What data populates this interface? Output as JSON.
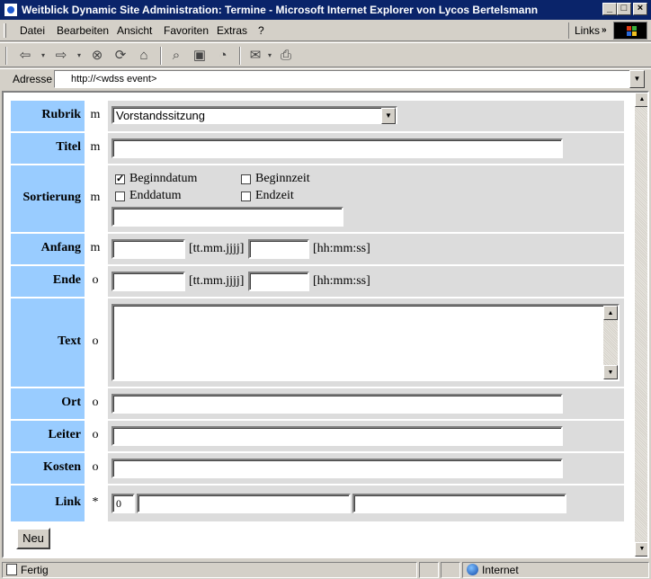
{
  "window": {
    "title": "Weitblick Dynamic Site Administration: Termine - Microsoft Internet Explorer von Lycos Bertelsmann",
    "controls": {
      "minimize": "_",
      "maximize": "□",
      "close": "×"
    }
  },
  "menu": {
    "items": [
      "Datei",
      "Bearbeiten",
      "Ansicht",
      "Favoriten",
      "Extras",
      "?"
    ],
    "links_label": "Links",
    "links_chevron": "»"
  },
  "toolbar": {
    "icons": [
      "back-icon",
      "forward-icon",
      "stop-icon",
      "refresh-icon",
      "home-icon",
      "search-icon",
      "favorites-icon",
      "history-icon",
      "mail-icon",
      "print-icon"
    ]
  },
  "address": {
    "label": "Adresse",
    "value": "http://<wdss event>"
  },
  "form": {
    "rubrik": {
      "label": "Rubrik",
      "flag": "m",
      "value": "Vorstandssitzung"
    },
    "titel": {
      "label": "Titel",
      "flag": "m",
      "value": ""
    },
    "sortierung": {
      "label": "Sortierung",
      "flag": "m",
      "options": [
        {
          "label": "Beginndatum",
          "checked": true
        },
        {
          "label": "Beginnzeit",
          "checked": false
        },
        {
          "label": "Enddatum",
          "checked": false
        },
        {
          "label": "Endzeit",
          "checked": false
        }
      ],
      "value": ""
    },
    "anfang": {
      "label": "Anfang",
      "flag": "m",
      "date_hint": "[tt.mm.jjjj]",
      "time_hint": "[hh:mm:ss]",
      "date": "",
      "time": ""
    },
    "ende": {
      "label": "Ende",
      "flag": "o",
      "date_hint": "[tt.mm.jjjj]",
      "time_hint": "[hh:mm:ss]",
      "date": "",
      "time": ""
    },
    "text": {
      "label": "Text",
      "flag": "o",
      "value": ""
    },
    "ort": {
      "label": "Ort",
      "flag": "o",
      "value": ""
    },
    "leiter": {
      "label": "Leiter",
      "flag": "o",
      "value": ""
    },
    "kosten": {
      "label": "Kosten",
      "flag": "o",
      "value": ""
    },
    "link": {
      "label": "Link",
      "flag": "*",
      "index": "0",
      "url": "",
      "caption": ""
    },
    "new_button": "Neu"
  },
  "status": {
    "text": "Fertig",
    "zone": "Internet"
  }
}
